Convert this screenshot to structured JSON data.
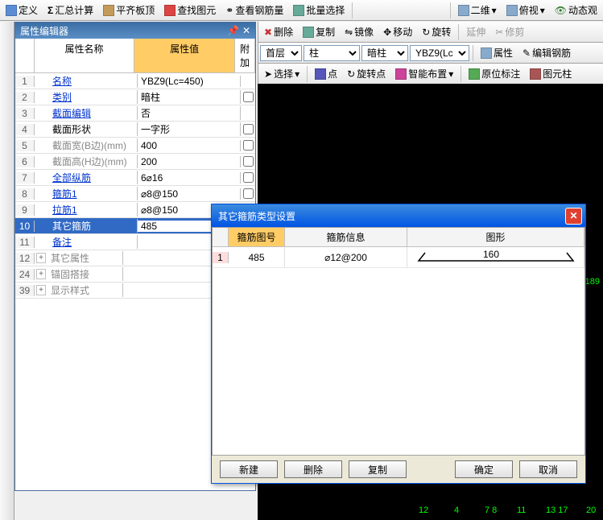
{
  "top_toolbar": {
    "define": "定义",
    "sigma": "汇总计算",
    "align_top": "平齐板顶",
    "find_elem": "查找图元",
    "find_rebar": "查看钢筋量",
    "batch_sel": "批量选择",
    "view2d": "二维",
    "view_top": "俯视",
    "dyn_view": "动态观"
  },
  "mid_toolbar": {
    "delete": "删除",
    "copy": "复制",
    "mirror": "镜像",
    "move": "移动",
    "rotate": "旋转",
    "extend": "延伸",
    "trim": "修剪"
  },
  "combo_row": {
    "floor": "首层",
    "category": "柱",
    "type": "暗柱",
    "code": "YBZ9(Lc",
    "props": "属性",
    "edit_rebar": "编辑钢筋"
  },
  "sel_row": {
    "select": "选择",
    "point": "点",
    "rotate_pt": "旋转点",
    "smart": "智能布置",
    "orig_label": "原位标注",
    "elem_cols": "图元柱"
  },
  "panel": {
    "title": "属性编辑器",
    "col_name": "属性名称",
    "col_value": "属性值",
    "col_extra": "附加",
    "rows": [
      {
        "n": "1",
        "name": "名称",
        "link": true,
        "val": "YBZ9(Lc=450)",
        "chk": false
      },
      {
        "n": "2",
        "name": "类别",
        "link": true,
        "val": "暗柱",
        "chk": true
      },
      {
        "n": "3",
        "name": "截面编辑",
        "link": true,
        "val": "否",
        "chk": false
      },
      {
        "n": "4",
        "name": "截面形状",
        "link": false,
        "val": "一字形",
        "chk": true
      },
      {
        "n": "5",
        "name": "截面宽(B边)(mm)",
        "gray": true,
        "val": "400",
        "chk": true
      },
      {
        "n": "6",
        "name": "截面高(H边)(mm)",
        "gray": true,
        "val": "200",
        "chk": true
      },
      {
        "n": "7",
        "name": "全部纵筋",
        "link": true,
        "val": "6⌀16",
        "chk": true
      },
      {
        "n": "8",
        "name": "箍筋1",
        "link": true,
        "val": "⌀8@150",
        "chk": true
      },
      {
        "n": "9",
        "name": "拉筋1",
        "link": true,
        "val": "⌀8@150",
        "chk": true
      },
      {
        "n": "10",
        "name": "其它箍筋",
        "link": false,
        "sel": true,
        "val": "485",
        "chk": true
      },
      {
        "n": "11",
        "name": "备注",
        "link": true,
        "val": "",
        "chk": true
      },
      {
        "n": "12",
        "name": "其它属性",
        "gray": true,
        "exp": "+",
        "val": "",
        "chk": false
      },
      {
        "n": "24",
        "name": "锚固搭接",
        "gray": true,
        "exp": "+",
        "val": "",
        "chk": false
      },
      {
        "n": "39",
        "name": "显示样式",
        "gray": true,
        "exp": "+",
        "val": "",
        "chk": false
      }
    ]
  },
  "dialog": {
    "title": "其它箍筋类型设置",
    "col_code": "箍筋图号",
    "col_info": "箍筋信息",
    "col_shape": "图形",
    "row": {
      "n": "1",
      "code": "485",
      "info": "⌀12@200",
      "dim": "160"
    },
    "btn_new": "新建",
    "btn_del": "删除",
    "btn_copy": "复制",
    "btn_ok": "确定",
    "btn_cancel": "取消"
  },
  "canvas_labels": [
    "189",
    "12",
    "4",
    "7 8",
    "11",
    "13 17",
    "20"
  ]
}
